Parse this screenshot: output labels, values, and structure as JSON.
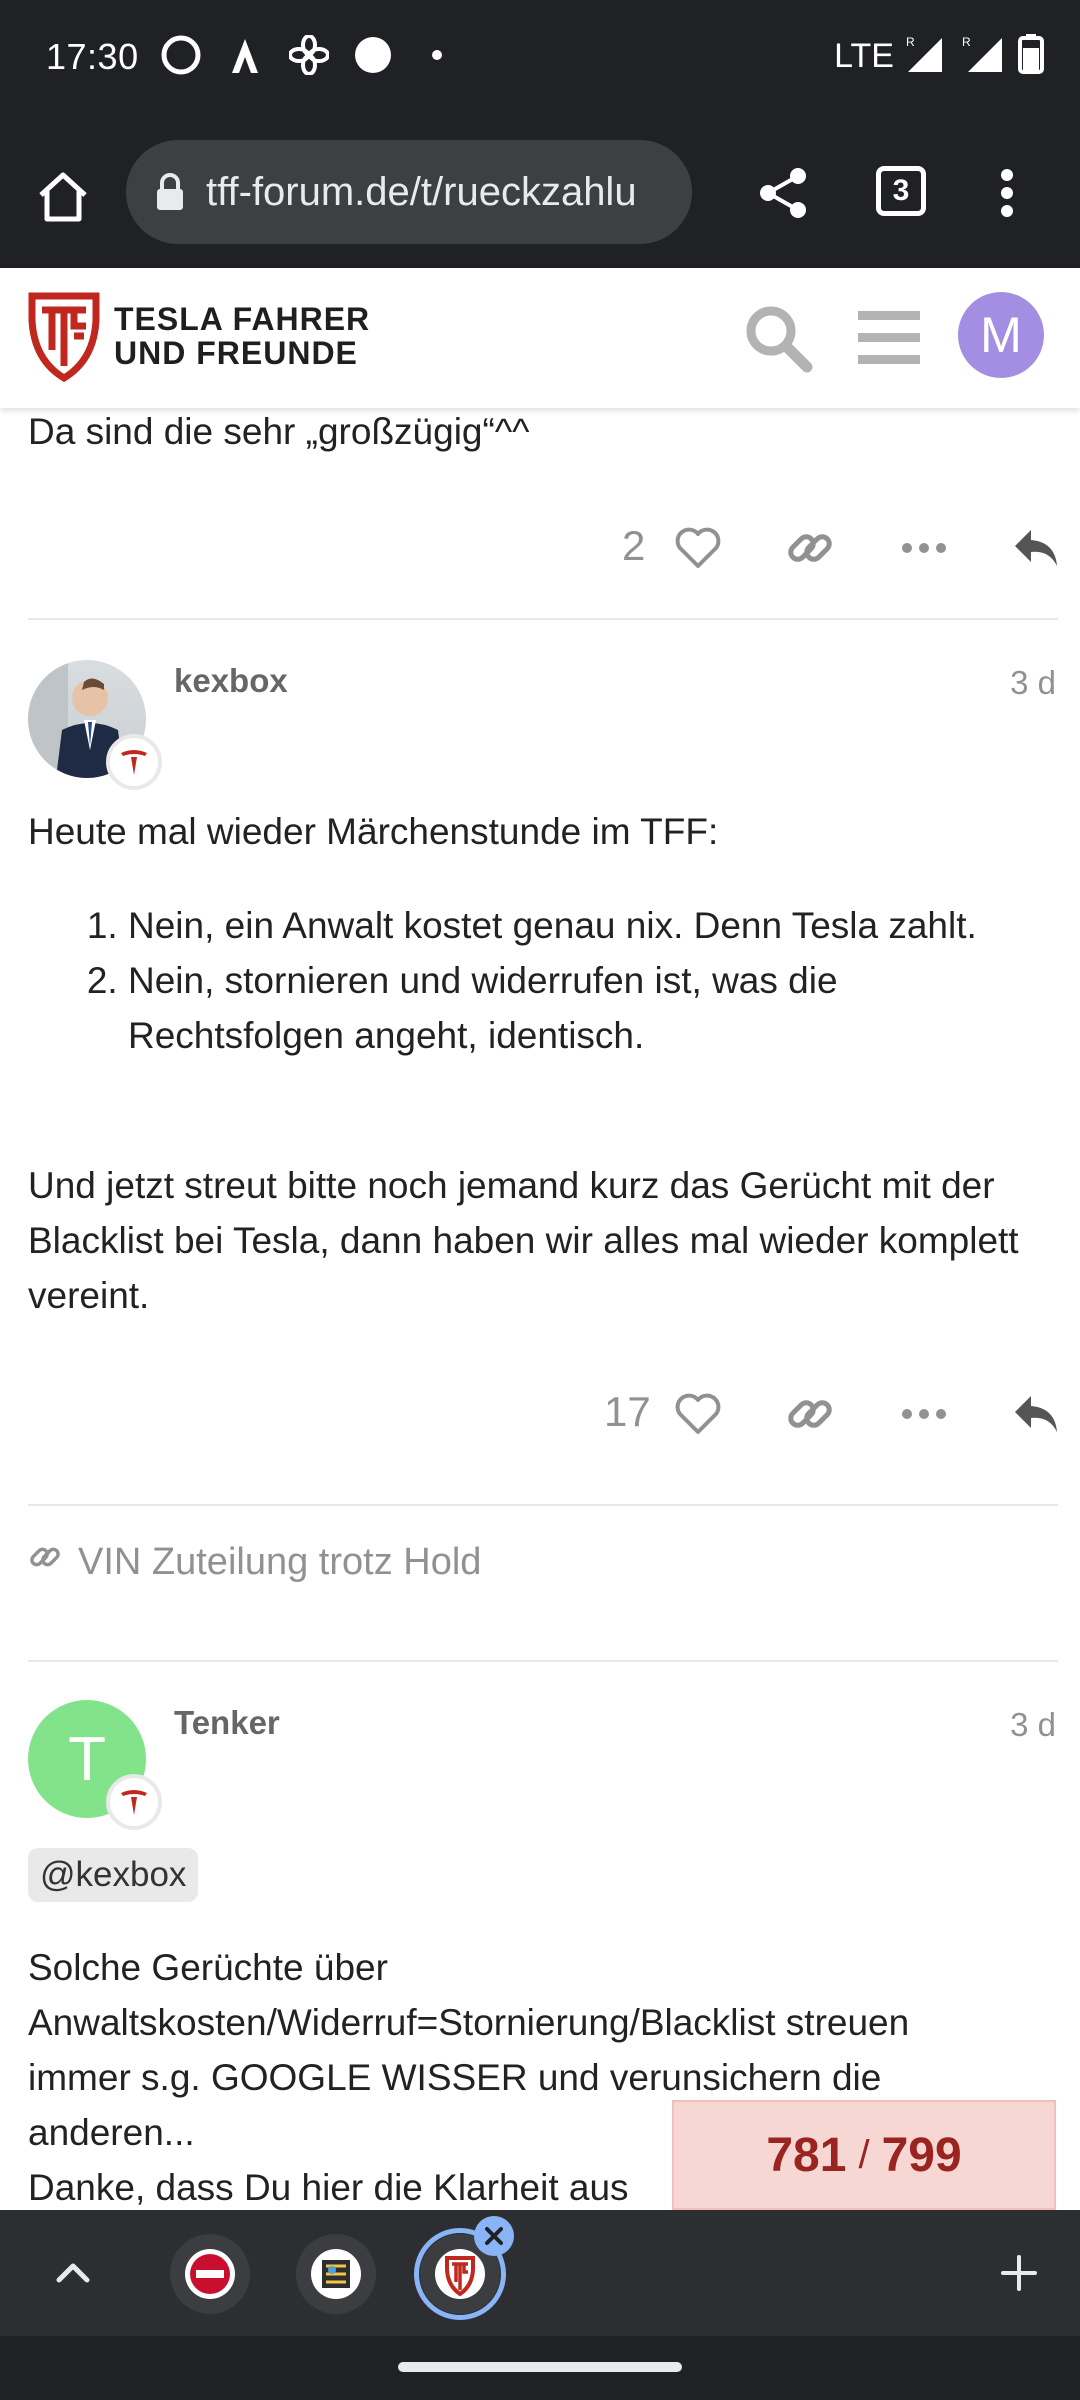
{
  "status_bar": {
    "time": "17:30",
    "network": "LTE",
    "icons": [
      "sync-icon",
      "strava-icon",
      "fan-icon",
      "circle-icon",
      "dot-icon",
      "signal-icon",
      "signal-icon",
      "battery-icon"
    ]
  },
  "browser": {
    "url": "tff-forum.de/t/rueckzahlu",
    "tab_count": "3"
  },
  "site": {
    "name_line1": "TESLA FAHRER",
    "name_line2": "UND FREUNDE",
    "avatar_letter": "M",
    "brand_color": "#c0281f",
    "avatar_color": "#a48ee3"
  },
  "posts": [
    {
      "body": "Da sind die sehr „großzügig“^^",
      "likes": "2"
    },
    {
      "username": "kexbox",
      "date": "3 d",
      "intro": "Heute mal wieder Märchenstunde im TFF:",
      "list": [
        "Nein, ein Anwalt kostet genau nix. Denn Tesla zahlt.",
        "Nein, stornieren und widerrufen ist, was die Rechtsfolgen angeht, identisch."
      ],
      "outro": "Und jetzt streut bitte noch jemand kurz das Gerücht mit der Blacklist bei Tesla, dann haben wir alles mal wieder komplett vereint.",
      "likes": "17"
    },
    {
      "username": "Tenker",
      "avatar_letter": "T",
      "avatar_color": "#82e38b",
      "date": "3 d",
      "mention": "@kexbox",
      "body_lines": [
        "Solche Gerüchte über",
        "Anwaltskosten/Widerruf=Stornierung/Blacklist streuen",
        "immer s.g. GOOGLE WISSER und verunsichern die",
        "anderen...",
        "Danke, dass Du hier die Klarheit aus"
      ]
    }
  ],
  "linked_topic": "VIN Zuteilung trotz Hold",
  "progress": {
    "current": "781",
    "separator": "/",
    "total": "799"
  }
}
